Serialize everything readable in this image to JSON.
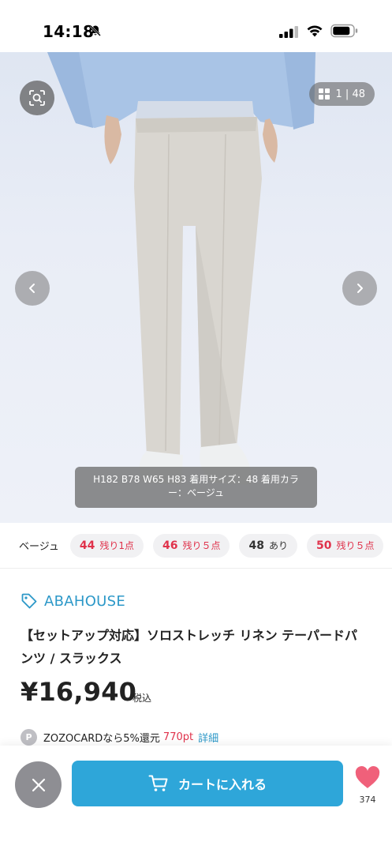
{
  "status_bar": {
    "time": "14:18",
    "icons": [
      "bell-slash-icon",
      "cellular-signal-icon",
      "wifi-icon",
      "battery-icon"
    ]
  },
  "gallery": {
    "counter": "1 | 48",
    "caption": "H182 B78 W65 H83 着用サイズ：48 着用カラー：ベージュ",
    "icons": [
      "zoom-search-icon",
      "grid-icon",
      "chevron-left-icon",
      "chevron-right-icon"
    ]
  },
  "variants": {
    "color_label": "ベージュ",
    "sizes": [
      {
        "size": "44",
        "stock": "残り1点",
        "status": "low"
      },
      {
        "size": "46",
        "stock": "残り５点",
        "status": "low"
      },
      {
        "size": "48",
        "stock": "あり",
        "status": "ok"
      },
      {
        "size": "50",
        "stock": "残り５点",
        "status": "low"
      }
    ]
  },
  "product": {
    "brand": "ABAHOUSE",
    "title": "【セットアップ対応】ソロストレッチ リネン テーパードパンツ / スラックス",
    "price": "¥16,940",
    "tax_label": "税込"
  },
  "zozocard": {
    "badge": "P",
    "text": "ZOZOCARDなら5%還元",
    "points": "770pt",
    "detail_link": "詳細"
  },
  "bottom_bar": {
    "cart_label": "カートに入れる",
    "like_count": "374"
  },
  "colors": {
    "accent_blue": "#2ea6d9",
    "brand_blue": "#2c98c8",
    "stock_red": "#e0324b",
    "like_pink": "#f0607a"
  }
}
